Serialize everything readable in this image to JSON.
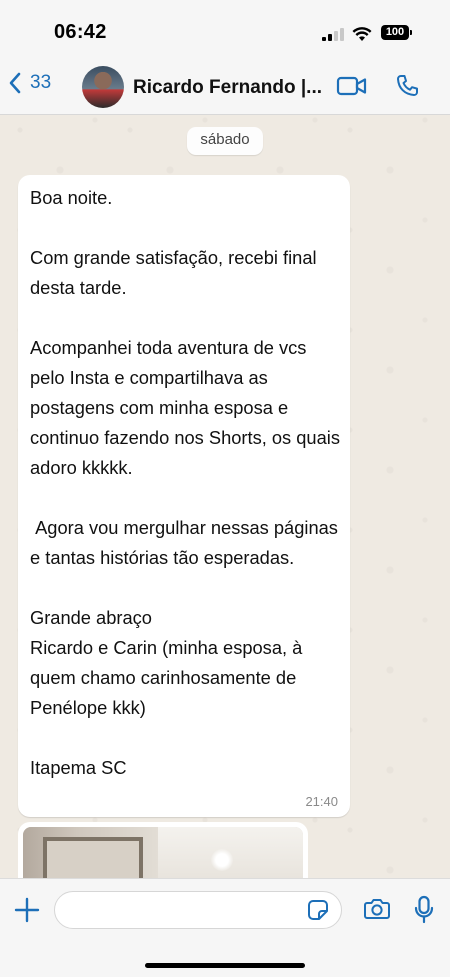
{
  "status_bar": {
    "time": "06:42",
    "battery": "100"
  },
  "header": {
    "back_count": "33",
    "contact_name": "Ricardo Fernando |...",
    "accent_color": "#1d6fb8"
  },
  "chat": {
    "date_separator": "sábado",
    "message": {
      "paragraphs": [
        "Boa noite.",
        "Com grande satisfação, recebi final desta tarde.",
        "Acompanhei toda aventura de vcs pelo Insta e compartilhava as postagens com minha esposa e continuo fazendo nos Shorts, os quais adoro kkkkk.",
        " Agora vou mergulhar nessas páginas e tantas histórias tão esperadas.",
        "Grande abraço\nRicardo e Carin (minha esposa, à quem chamo carinhosamente de Penélope kkk)",
        "Itapema SC"
      ],
      "time": "21:40"
    }
  },
  "composer": {
    "input_value": "",
    "input_placeholder": ""
  },
  "icons": {
    "back": "chevron-left-icon",
    "video": "video-camera-icon",
    "call": "phone-icon",
    "attach": "plus-icon",
    "sticker": "sticker-icon",
    "camera": "camera-icon",
    "mic": "microphone-icon"
  }
}
